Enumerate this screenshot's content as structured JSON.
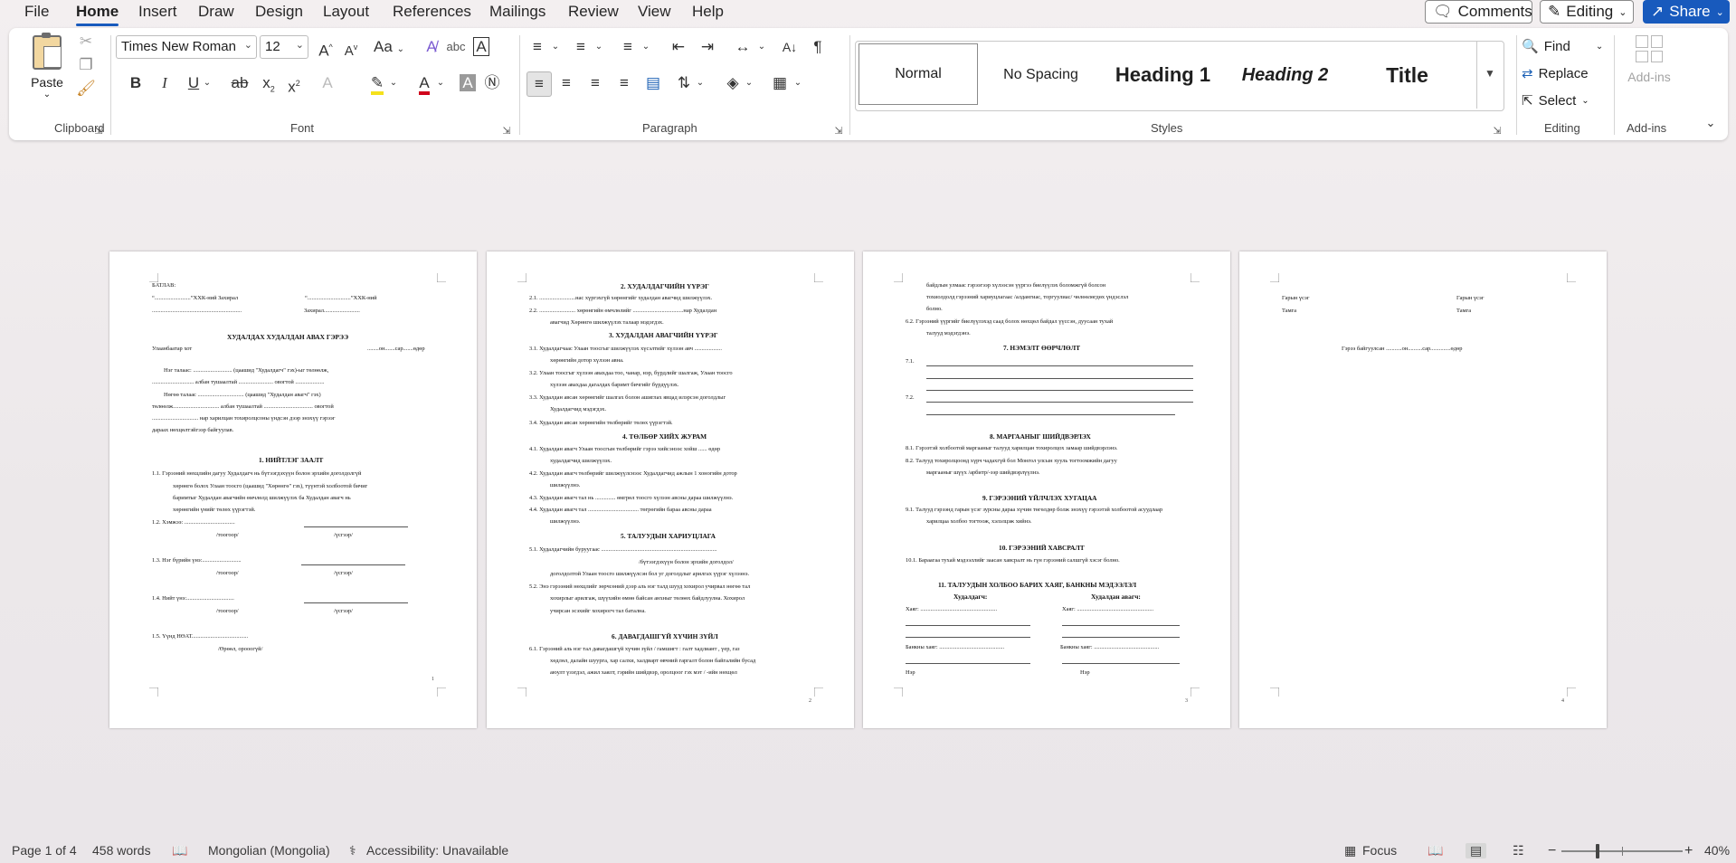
{
  "menu": {
    "tabs": [
      "File",
      "Home",
      "Insert",
      "Draw",
      "Design",
      "Layout",
      "References",
      "Mailings",
      "Review",
      "View",
      "Help"
    ],
    "comments": "Comments",
    "editing": "Editing",
    "share": "Share"
  },
  "ribbon": {
    "clipboard": {
      "label": "Clipboard",
      "paste": "Paste"
    },
    "font": {
      "label": "Font",
      "name": "Times New Roman",
      "size": "12"
    },
    "paragraph": {
      "label": "Paragraph"
    },
    "styles": {
      "label": "Styles",
      "items": [
        "Normal",
        "No Spacing",
        "Heading 1",
        "Heading 2",
        "Title"
      ]
    },
    "editing": {
      "label": "Editing",
      "find": "Find",
      "replace": "Replace",
      "select": "Select"
    },
    "addins": {
      "label": "Add-ins",
      "btn": "Add-ins"
    }
  },
  "pages": {
    "p1": {
      "l1": "БАТЛАВ:",
      "l2a": "“.........................”ХХК-ний Захирал",
      "l2b": "“..............................”ХХК-ний",
      "l3": "Захирал.........................",
      "title": "ХУДАЛДАХ ХУДАЛДАН АВАХ ГЭРЭЭ",
      "city": "Улаанбаатар хот",
      "date": "........он.......сар.......өдөр",
      "para1": "Нэг талаас: ........................... (цаашид \"Худалдагч\" гэх)-ыг төлөөлж,",
      "para2": "............................. албан тушаалтай ........................ овогтой ....................",
      "para3": "Нөгөө талаас ................................ (цаашид \"Худалдан авагч\" гэх)",
      "para4": "төлөөлж................................ албан тушаалтай .................................. овогтой",
      "para5": "................................ нар харилцан тохиролцсоны үндсэн дээр энэхүү гэрээг",
      "para6": "дараах нөхцөлтэйгээр байгуулав.",
      "h1": "1.   НИЙТЛЭГ ЗААЛТ",
      "s11a": "1.1.      Гэрээний нөхцлийн дагуу Худалдагч нь бүтээгдэхүүн болон эрхийн доголдолгүй",
      "s11b": "хөрөнгө болох Улаан тоосго (цаашид \"Хөрөнгө\" гэх), түүнтэй холбоотой бичиг",
      "s11c": "баримтыг Худалдан авагчийн өмчлөлд шилжүүлэх ба Худалдан авагч нь",
      "s11d": "хөрөнгийн үнийг төлөх үүрэгтэй.",
      "s12": "1.2.      Хэмжээ: ...................................",
      "s13": "1.3.      Нэг бүрийн үнэ:...........................",
      "s14": "1.4.      Нийт үнэ:.................................",
      "s15": "1.5.      Үүнд НӨАТ.......................................",
      "tooor": "/тоогоор/",
      "usgeer": "/үсгээр/",
      "orom": "/Өрөөл, орооогүй/",
      "num": "1"
    },
    "p2": {
      "h2": "2.   ХУДАЛДАГЧИЙН ҮҮРЭГ",
      "a21": "2.1.      .........................нас хүргэхгүй хөрөнгийг худалдан авагчид шилжүүлэх.",
      "a22": "2.2.      ......................... хөрөнгийн өмчлөлийг ...................................нар Худалдан",
      "a22b": "авагчид Хөрөнгө шилжүүлэх талаар мэдэгдэх.",
      "h3": "3.   ХУДАЛДАН АВАГЧИЙН ҮҮРЭГ",
      "a31": "3.1.      Худалдагчаас Улаан тоосгыг шилжүүлэх хүсэлтийг хүлээн авч ...................",
      "a31b": "хөрөнгийн дотор хүлээн авна.",
      "a32": "3.2.      Улаан тоосгыг хүлээн авахдаа тоо, чанар, нэр, бүрдлийг шалгаж, Улаан тоосго",
      "a32b": "хүлээн авахдаа дагалдах баримт бичгийг бүрдүүлэх.",
      "a33": "3.3.      Худалдан авсан хөрөнгийг шалгах болон ашиглах явцад илэрсэн доголдлыг",
      "a33b": "Худалдагчид мэдэгдэх.",
      "a34": "3.4.      Худалдан авсан хөрөнгийн төлбөрийг төлөх үүрэгтэй.",
      "h4": "4.   ТӨЛБӨР ХИЙХ ЖУРАМ",
      "a41": "4.1.      Худалдан авагч Улаан тоосгын төлбөрийг гэрээ хийсэнээс хойш ...... өдөр",
      "a41b": "худалдагчид шилжүүлэх.",
      "a42": "4.2.      Худалдан авагч төлбөрийг шилжүүлснээс Худалдагчид ажлын 1 хоногийн дотор",
      "a42b": "шилжүүлнэ.",
      "a43": "4.3.      Худалдан авагч тал нь .............. өмгрөл тоосго хүлээн авсны дараа шилжүүлнэ.",
      "a44": "4.4.      Худалдан авагч тал ................................... төгрөгийн бараа авсны дараа",
      "a44b": "шилжүүлнэ.",
      "h5": "5.   ТАЛУУДЫН ХАРИУЦЛАГА",
      "a51": "5.1.      Худалдагчийн буруугаас ................................................................................",
      "a51b": "/бүтээгдэхүүн болон эрхийн доголдол/",
      "a51c": "доголдолтой Улаан тоосго шилжүүлсэн бол уг доголдлыг арилгах үүрэг хүлээнэ.",
      "a52": "5.2.      Энэ гэрээний нөхцлийг зөрчсөний дээр аль нэг талд шууд хохирол учирвал нөгөө тал",
      "a52b": "хохирлыг арилгаж, шүүхийн өмнө байсан анхныг төлөөх байдлуулна. Хохирол",
      "a52c": "учирсан эсэхийг хохирогч тал батална.",
      "h6": "6.   ДАВАГДАШГҮЙ ХҮЧИН ЗҮЙЛ",
      "a61": "6.1.      Гэрээний аль нэг тал давагдашгүй хүчин зүйл / гамшигт : галт хадлиант , үер, газ",
      "a61b": "хөдлөл, далайн шуурга, хар салхи, халдварт өвчний гаргалт болон байгалийн бусад",
      "a61c": "аюулт үзэгдэл, ажил хаялт, гэрийн шийдвэр, оролцоог гэх мэт / -ийн нөхцөл",
      "num": "2"
    },
    "p3": {
      "b1": "байдлын улмаас гэрээгээр хүлээсэн үүргээ биелүүлэх боломжгүй болсон",
      "b2": "тохиолдолд гэрээний хариуцлагаас /алдангиас, торгуулиас/ чөлөөлөгдөх үндэслэл",
      "b3": "болно.",
      "b62": "6.2.      Гэрээний үүргийг биелүүлэхэд саад болох нөхцөл байдал үүссэн, дуусаан тухай",
      "b62b": "талууд мэдэгдэнэ.",
      "h7": "7.   НЭМЭЛТ ӨӨРЧЛӨЛТ",
      "c71": "7.1.",
      "c72": "7.2.",
      "h8": "8.   МАРГААНЫГ ШИЙДВЭРЛЭХ",
      "c81": "8.1.      Гэрээтэй холбоотой маргааныг талууд харилцан тохиролцох замаар шийдвэрлэнэ.",
      "c82": "8.2.      Талууд тохиролцоонд хүрч чадахгүй бол Монгол улсын хууль тогтоомжийн дагуу",
      "c82b": "маргааныг шүүх /арбитр/-ээр шийдвэрлүүлнэ.",
      "h9": "9.   ГЭРЭЭНИЙ ҮЙЛЧЛЭХ ХУГАЦАА",
      "c91": "9.1.      Талууд гэрээнд гарын үсэг зурсны дараа хүчин төгөлдөр болж энэхүү гэрээтэй холбоотой асуудлаар",
      "c91b": "харилцаа холбоо тогтоож, хэлэлцэж хийнэ.",
      "h10": "10.   ГЭРЭЭНИЙ ХАВСРАЛТ",
      "c101": "10.1.      Бараагаа тухай мэдээллийг заасан хавсралт нь гүн гэрээний салшгүй хэсэг болно.",
      "h11": "11.   ТАЛУУДЫН ХОЛБОО БАРИХ ХАЯГ, БАНКНЫ МЭДЭЭЛЭЛ",
      "seller": "Худалдагч:",
      "buyer": "Худалдан авагч:",
      "addr": "Хаяг: .....................................................",
      "bank": "Банкны хаяг: .............................................",
      "ner": "Нэр",
      "num": "3"
    },
    "p4": {
      "sig1": "Гарын үсэг",
      "sig2": "Гарын үсэг",
      "stamp1": "Тамга",
      "stamp2": "Тамга",
      "date": "Гэрээ байгуулсан ...........он..........сар..............өдөр",
      "num": "4"
    }
  },
  "status": {
    "page": "Page 1 of 4",
    "words": "458 words",
    "lang": "Mongolian (Mongolia)",
    "access": "Accessibility: Unavailable",
    "focus": "Focus",
    "zoom": "40%",
    "zoom_value": 40
  }
}
